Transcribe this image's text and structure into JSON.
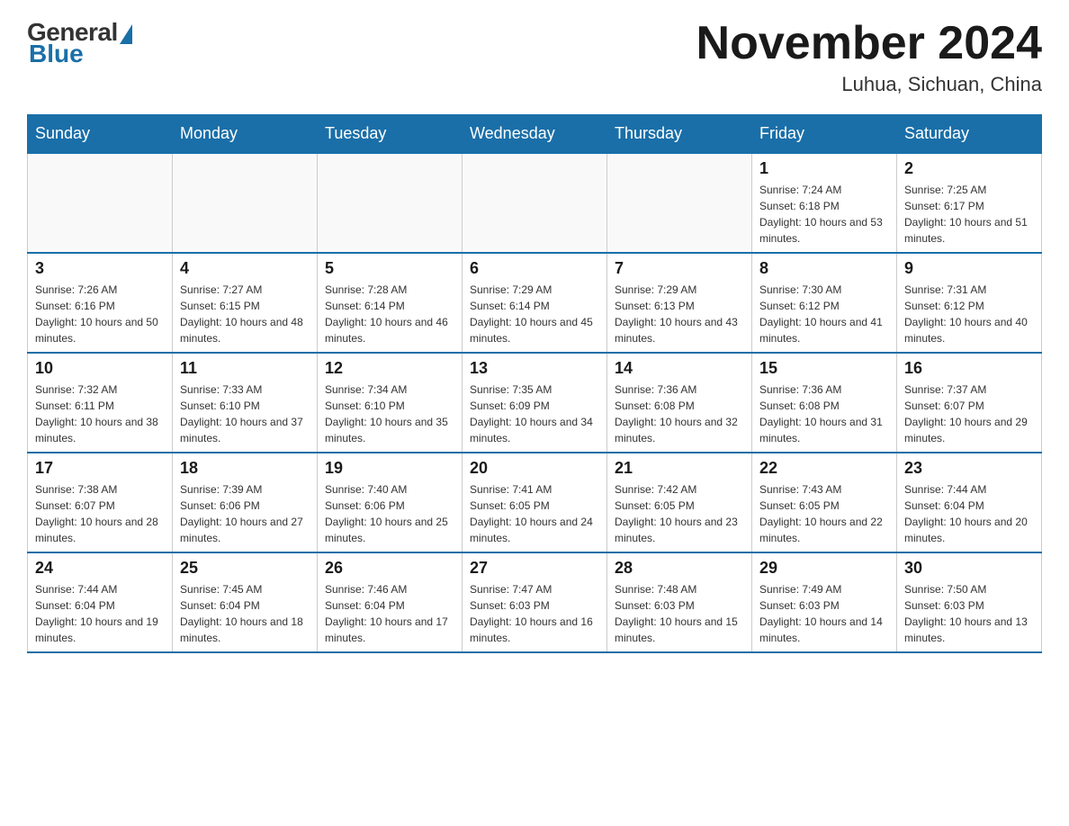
{
  "header": {
    "logo": {
      "general": "General",
      "blue": "Blue"
    },
    "title": "November 2024",
    "location": "Luhua, Sichuan, China"
  },
  "weekdays": [
    "Sunday",
    "Monday",
    "Tuesday",
    "Wednesday",
    "Thursday",
    "Friday",
    "Saturday"
  ],
  "weeks": [
    [
      {
        "day": "",
        "info": ""
      },
      {
        "day": "",
        "info": ""
      },
      {
        "day": "",
        "info": ""
      },
      {
        "day": "",
        "info": ""
      },
      {
        "day": "",
        "info": ""
      },
      {
        "day": "1",
        "info": "Sunrise: 7:24 AM\nSunset: 6:18 PM\nDaylight: 10 hours and 53 minutes."
      },
      {
        "day": "2",
        "info": "Sunrise: 7:25 AM\nSunset: 6:17 PM\nDaylight: 10 hours and 51 minutes."
      }
    ],
    [
      {
        "day": "3",
        "info": "Sunrise: 7:26 AM\nSunset: 6:16 PM\nDaylight: 10 hours and 50 minutes."
      },
      {
        "day": "4",
        "info": "Sunrise: 7:27 AM\nSunset: 6:15 PM\nDaylight: 10 hours and 48 minutes."
      },
      {
        "day": "5",
        "info": "Sunrise: 7:28 AM\nSunset: 6:14 PM\nDaylight: 10 hours and 46 minutes."
      },
      {
        "day": "6",
        "info": "Sunrise: 7:29 AM\nSunset: 6:14 PM\nDaylight: 10 hours and 45 minutes."
      },
      {
        "day": "7",
        "info": "Sunrise: 7:29 AM\nSunset: 6:13 PM\nDaylight: 10 hours and 43 minutes."
      },
      {
        "day": "8",
        "info": "Sunrise: 7:30 AM\nSunset: 6:12 PM\nDaylight: 10 hours and 41 minutes."
      },
      {
        "day": "9",
        "info": "Sunrise: 7:31 AM\nSunset: 6:12 PM\nDaylight: 10 hours and 40 minutes."
      }
    ],
    [
      {
        "day": "10",
        "info": "Sunrise: 7:32 AM\nSunset: 6:11 PM\nDaylight: 10 hours and 38 minutes."
      },
      {
        "day": "11",
        "info": "Sunrise: 7:33 AM\nSunset: 6:10 PM\nDaylight: 10 hours and 37 minutes."
      },
      {
        "day": "12",
        "info": "Sunrise: 7:34 AM\nSunset: 6:10 PM\nDaylight: 10 hours and 35 minutes."
      },
      {
        "day": "13",
        "info": "Sunrise: 7:35 AM\nSunset: 6:09 PM\nDaylight: 10 hours and 34 minutes."
      },
      {
        "day": "14",
        "info": "Sunrise: 7:36 AM\nSunset: 6:08 PM\nDaylight: 10 hours and 32 minutes."
      },
      {
        "day": "15",
        "info": "Sunrise: 7:36 AM\nSunset: 6:08 PM\nDaylight: 10 hours and 31 minutes."
      },
      {
        "day": "16",
        "info": "Sunrise: 7:37 AM\nSunset: 6:07 PM\nDaylight: 10 hours and 29 minutes."
      }
    ],
    [
      {
        "day": "17",
        "info": "Sunrise: 7:38 AM\nSunset: 6:07 PM\nDaylight: 10 hours and 28 minutes."
      },
      {
        "day": "18",
        "info": "Sunrise: 7:39 AM\nSunset: 6:06 PM\nDaylight: 10 hours and 27 minutes."
      },
      {
        "day": "19",
        "info": "Sunrise: 7:40 AM\nSunset: 6:06 PM\nDaylight: 10 hours and 25 minutes."
      },
      {
        "day": "20",
        "info": "Sunrise: 7:41 AM\nSunset: 6:05 PM\nDaylight: 10 hours and 24 minutes."
      },
      {
        "day": "21",
        "info": "Sunrise: 7:42 AM\nSunset: 6:05 PM\nDaylight: 10 hours and 23 minutes."
      },
      {
        "day": "22",
        "info": "Sunrise: 7:43 AM\nSunset: 6:05 PM\nDaylight: 10 hours and 22 minutes."
      },
      {
        "day": "23",
        "info": "Sunrise: 7:44 AM\nSunset: 6:04 PM\nDaylight: 10 hours and 20 minutes."
      }
    ],
    [
      {
        "day": "24",
        "info": "Sunrise: 7:44 AM\nSunset: 6:04 PM\nDaylight: 10 hours and 19 minutes."
      },
      {
        "day": "25",
        "info": "Sunrise: 7:45 AM\nSunset: 6:04 PM\nDaylight: 10 hours and 18 minutes."
      },
      {
        "day": "26",
        "info": "Sunrise: 7:46 AM\nSunset: 6:04 PM\nDaylight: 10 hours and 17 minutes."
      },
      {
        "day": "27",
        "info": "Sunrise: 7:47 AM\nSunset: 6:03 PM\nDaylight: 10 hours and 16 minutes."
      },
      {
        "day": "28",
        "info": "Sunrise: 7:48 AM\nSunset: 6:03 PM\nDaylight: 10 hours and 15 minutes."
      },
      {
        "day": "29",
        "info": "Sunrise: 7:49 AM\nSunset: 6:03 PM\nDaylight: 10 hours and 14 minutes."
      },
      {
        "day": "30",
        "info": "Sunrise: 7:50 AM\nSunset: 6:03 PM\nDaylight: 10 hours and 13 minutes."
      }
    ]
  ]
}
